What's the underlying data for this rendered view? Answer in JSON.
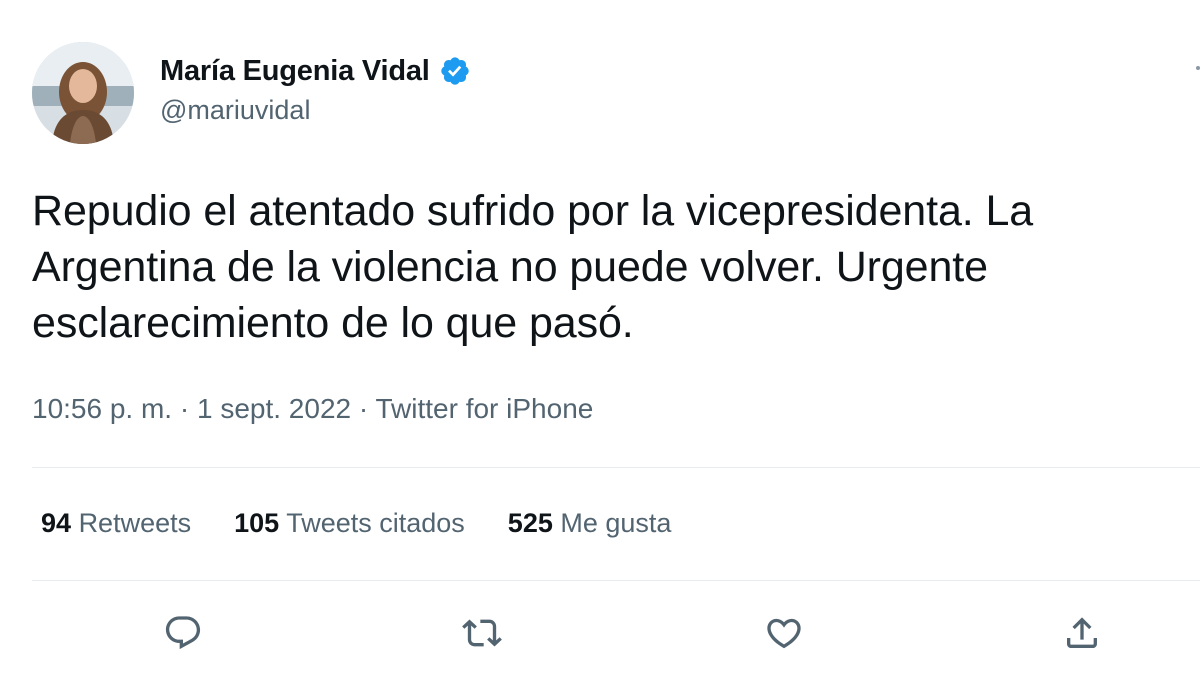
{
  "author": {
    "name": "María Eugenia Vidal",
    "handle": "@mariuvidal",
    "verified": true
  },
  "tweet": {
    "text": "Repudio el atentado sufrido por la vicepresidenta. La Argentina de la violencia no puede volver. Urgente esclarecimiento de lo que pasó.",
    "meta": "10:56 p. m. · 1 sept. 2022 · Twitter for iPhone"
  },
  "stats": [
    {
      "count": "94",
      "label": "Retweets"
    },
    {
      "count": "105",
      "label": "Tweets citados"
    },
    {
      "count": "525",
      "label": "Me gusta"
    }
  ],
  "actions": {
    "reply_icon": "reply-icon",
    "retweet_icon": "retweet-icon",
    "like_icon": "heart-icon",
    "share_icon": "share-icon"
  },
  "colors": {
    "text": "#0f1419",
    "secondary": "#536471",
    "verified": "#1d9bf0",
    "divider": "#e6ecf0"
  }
}
